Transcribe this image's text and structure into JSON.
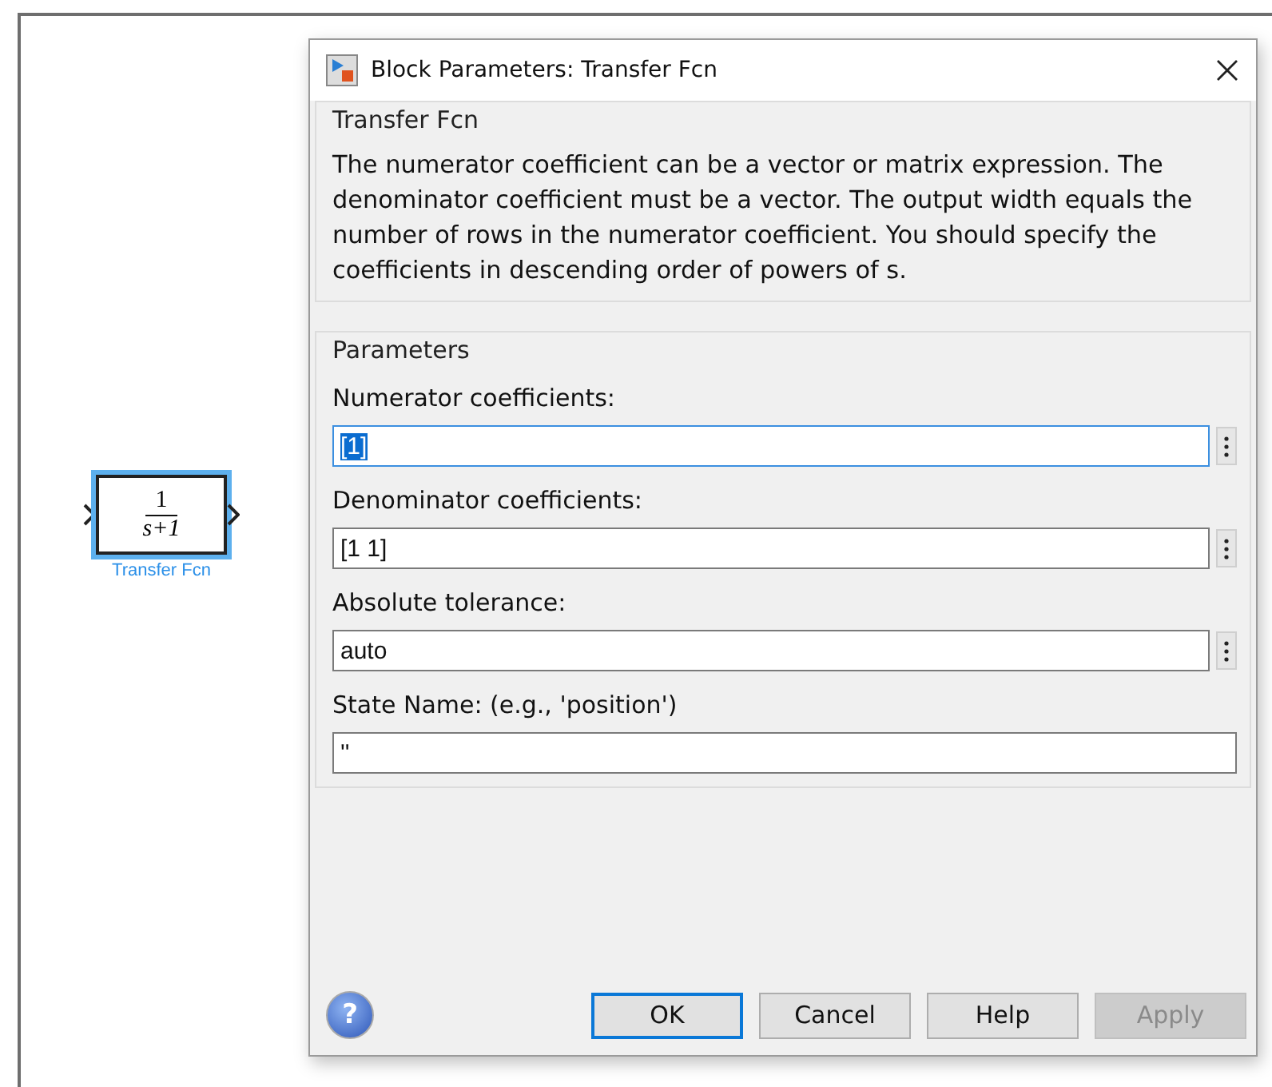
{
  "canvas": {
    "block": {
      "numerator": "1",
      "denominator": "s+1",
      "label": "Transfer Fcn",
      "selected": true
    }
  },
  "dialog": {
    "title": "Block Parameters: Transfer Fcn",
    "description": {
      "title": "Transfer Fcn",
      "text": "The numerator coefficient can be a vector or matrix expression. The denominator coefficient must be a vector. The output width equals the number of rows in the numerator coefficient. You should specify the coefficients in descending order of powers of s."
    },
    "parameters": {
      "title": "Parameters",
      "fields": [
        {
          "label": "Numerator coefficients:",
          "value": "[1]",
          "focused": true,
          "text_selected": true,
          "has_menu": true
        },
        {
          "label": "Denominator coefficients:",
          "value": "[1 1]",
          "focused": false,
          "text_selected": false,
          "has_menu": true
        },
        {
          "label": "Absolute tolerance:",
          "value": "auto",
          "focused": false,
          "text_selected": false,
          "has_menu": true
        },
        {
          "label": "State Name: (e.g., 'position')",
          "value": "''",
          "focused": false,
          "text_selected": false,
          "has_menu": false
        }
      ]
    },
    "help_glyph": "?",
    "buttons": [
      {
        "label": "OK",
        "default": true,
        "disabled": false
      },
      {
        "label": "Cancel",
        "default": false,
        "disabled": false
      },
      {
        "label": "Help",
        "default": false,
        "disabled": false
      },
      {
        "label": "Apply",
        "default": false,
        "disabled": true
      }
    ]
  }
}
